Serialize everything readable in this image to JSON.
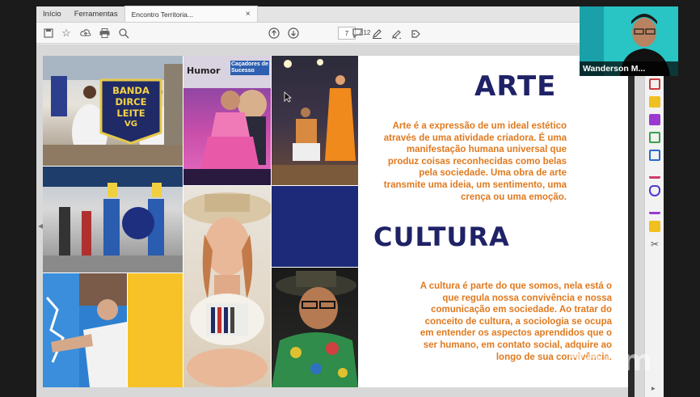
{
  "tabs": [
    {
      "label": "Início"
    },
    {
      "label": "Ferramentas"
    },
    {
      "label": "Encontro Territoria..."
    }
  ],
  "toolbar": {
    "current_page": "7",
    "total_pages": "/ 12"
  },
  "slide": {
    "heading1": "ARTE",
    "paragraph1": "Arte é a expressão de um ideal estético através de uma atividade criadora. É uma manifestação humana universal que produz coisas reconhecidas como belas pela sociedade. Uma obra de arte transmite uma ideia, um sentimento, uma crença ou uma emoção.",
    "heading2": "CULTURA",
    "paragraph2": "A cultura é parte do que somos, nela está o que regula nossa convivência e nossa comunicação em sociedade. Ao tratar do conceito de cultura, a sociologia se ocupa em entender os aspectos aprendidos que o ser humano, em contato social, adquire ao longo de sua convivência.",
    "banner_lines": [
      "BANDA",
      "DIRCE",
      "LEITE",
      "VG"
    ],
    "poster_text": "Humor",
    "poster_text2": "Caçadores de Sucesso"
  },
  "video": {
    "participant_name": "Wanderson M..."
  },
  "watermark": "zoom",
  "colors": {
    "heading": "#1f2266",
    "paragraph": "#e07a1f",
    "navy_block": "#1d2a7a",
    "yellow_block": "#f7c228"
  }
}
